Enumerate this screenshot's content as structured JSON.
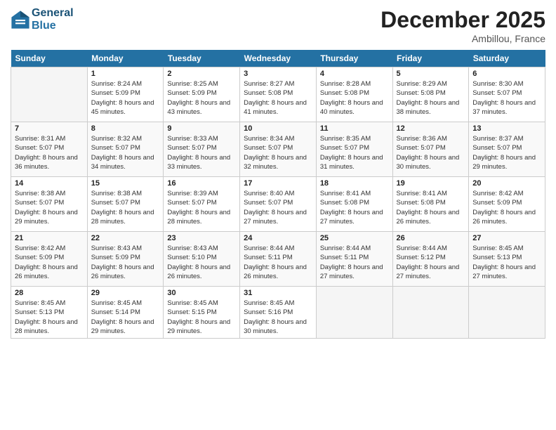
{
  "logo": {
    "line1": "General",
    "line2": "Blue"
  },
  "title": "December 2025",
  "subtitle": "Ambillou, France",
  "days_header": [
    "Sunday",
    "Monday",
    "Tuesday",
    "Wednesday",
    "Thursday",
    "Friday",
    "Saturday"
  ],
  "weeks": [
    [
      {
        "num": "",
        "sunrise": "",
        "sunset": "",
        "daylight": ""
      },
      {
        "num": "1",
        "sunrise": "Sunrise: 8:24 AM",
        "sunset": "Sunset: 5:09 PM",
        "daylight": "Daylight: 8 hours and 45 minutes."
      },
      {
        "num": "2",
        "sunrise": "Sunrise: 8:25 AM",
        "sunset": "Sunset: 5:09 PM",
        "daylight": "Daylight: 8 hours and 43 minutes."
      },
      {
        "num": "3",
        "sunrise": "Sunrise: 8:27 AM",
        "sunset": "Sunset: 5:08 PM",
        "daylight": "Daylight: 8 hours and 41 minutes."
      },
      {
        "num": "4",
        "sunrise": "Sunrise: 8:28 AM",
        "sunset": "Sunset: 5:08 PM",
        "daylight": "Daylight: 8 hours and 40 minutes."
      },
      {
        "num": "5",
        "sunrise": "Sunrise: 8:29 AM",
        "sunset": "Sunset: 5:08 PM",
        "daylight": "Daylight: 8 hours and 38 minutes."
      },
      {
        "num": "6",
        "sunrise": "Sunrise: 8:30 AM",
        "sunset": "Sunset: 5:07 PM",
        "daylight": "Daylight: 8 hours and 37 minutes."
      }
    ],
    [
      {
        "num": "7",
        "sunrise": "Sunrise: 8:31 AM",
        "sunset": "Sunset: 5:07 PM",
        "daylight": "Daylight: 8 hours and 36 minutes."
      },
      {
        "num": "8",
        "sunrise": "Sunrise: 8:32 AM",
        "sunset": "Sunset: 5:07 PM",
        "daylight": "Daylight: 8 hours and 34 minutes."
      },
      {
        "num": "9",
        "sunrise": "Sunrise: 8:33 AM",
        "sunset": "Sunset: 5:07 PM",
        "daylight": "Daylight: 8 hours and 33 minutes."
      },
      {
        "num": "10",
        "sunrise": "Sunrise: 8:34 AM",
        "sunset": "Sunset: 5:07 PM",
        "daylight": "Daylight: 8 hours and 32 minutes."
      },
      {
        "num": "11",
        "sunrise": "Sunrise: 8:35 AM",
        "sunset": "Sunset: 5:07 PM",
        "daylight": "Daylight: 8 hours and 31 minutes."
      },
      {
        "num": "12",
        "sunrise": "Sunrise: 8:36 AM",
        "sunset": "Sunset: 5:07 PM",
        "daylight": "Daylight: 8 hours and 30 minutes."
      },
      {
        "num": "13",
        "sunrise": "Sunrise: 8:37 AM",
        "sunset": "Sunset: 5:07 PM",
        "daylight": "Daylight: 8 hours and 29 minutes."
      }
    ],
    [
      {
        "num": "14",
        "sunrise": "Sunrise: 8:38 AM",
        "sunset": "Sunset: 5:07 PM",
        "daylight": "Daylight: 8 hours and 29 minutes."
      },
      {
        "num": "15",
        "sunrise": "Sunrise: 8:38 AM",
        "sunset": "Sunset: 5:07 PM",
        "daylight": "Daylight: 8 hours and 28 minutes."
      },
      {
        "num": "16",
        "sunrise": "Sunrise: 8:39 AM",
        "sunset": "Sunset: 5:07 PM",
        "daylight": "Daylight: 8 hours and 28 minutes."
      },
      {
        "num": "17",
        "sunrise": "Sunrise: 8:40 AM",
        "sunset": "Sunset: 5:07 PM",
        "daylight": "Daylight: 8 hours and 27 minutes."
      },
      {
        "num": "18",
        "sunrise": "Sunrise: 8:41 AM",
        "sunset": "Sunset: 5:08 PM",
        "daylight": "Daylight: 8 hours and 27 minutes."
      },
      {
        "num": "19",
        "sunrise": "Sunrise: 8:41 AM",
        "sunset": "Sunset: 5:08 PM",
        "daylight": "Daylight: 8 hours and 26 minutes."
      },
      {
        "num": "20",
        "sunrise": "Sunrise: 8:42 AM",
        "sunset": "Sunset: 5:09 PM",
        "daylight": "Daylight: 8 hours and 26 minutes."
      }
    ],
    [
      {
        "num": "21",
        "sunrise": "Sunrise: 8:42 AM",
        "sunset": "Sunset: 5:09 PM",
        "daylight": "Daylight: 8 hours and 26 minutes."
      },
      {
        "num": "22",
        "sunrise": "Sunrise: 8:43 AM",
        "sunset": "Sunset: 5:09 PM",
        "daylight": "Daylight: 8 hours and 26 minutes."
      },
      {
        "num": "23",
        "sunrise": "Sunrise: 8:43 AM",
        "sunset": "Sunset: 5:10 PM",
        "daylight": "Daylight: 8 hours and 26 minutes."
      },
      {
        "num": "24",
        "sunrise": "Sunrise: 8:44 AM",
        "sunset": "Sunset: 5:11 PM",
        "daylight": "Daylight: 8 hours and 26 minutes."
      },
      {
        "num": "25",
        "sunrise": "Sunrise: 8:44 AM",
        "sunset": "Sunset: 5:11 PM",
        "daylight": "Daylight: 8 hours and 27 minutes."
      },
      {
        "num": "26",
        "sunrise": "Sunrise: 8:44 AM",
        "sunset": "Sunset: 5:12 PM",
        "daylight": "Daylight: 8 hours and 27 minutes."
      },
      {
        "num": "27",
        "sunrise": "Sunrise: 8:45 AM",
        "sunset": "Sunset: 5:13 PM",
        "daylight": "Daylight: 8 hours and 27 minutes."
      }
    ],
    [
      {
        "num": "28",
        "sunrise": "Sunrise: 8:45 AM",
        "sunset": "Sunset: 5:13 PM",
        "daylight": "Daylight: 8 hours and 28 minutes."
      },
      {
        "num": "29",
        "sunrise": "Sunrise: 8:45 AM",
        "sunset": "Sunset: 5:14 PM",
        "daylight": "Daylight: 8 hours and 29 minutes."
      },
      {
        "num": "30",
        "sunrise": "Sunrise: 8:45 AM",
        "sunset": "Sunset: 5:15 PM",
        "daylight": "Daylight: 8 hours and 29 minutes."
      },
      {
        "num": "31",
        "sunrise": "Sunrise: 8:45 AM",
        "sunset": "Sunset: 5:16 PM",
        "daylight": "Daylight: 8 hours and 30 minutes."
      },
      {
        "num": "",
        "sunrise": "",
        "sunset": "",
        "daylight": ""
      },
      {
        "num": "",
        "sunrise": "",
        "sunset": "",
        "daylight": ""
      },
      {
        "num": "",
        "sunrise": "",
        "sunset": "",
        "daylight": ""
      }
    ]
  ]
}
